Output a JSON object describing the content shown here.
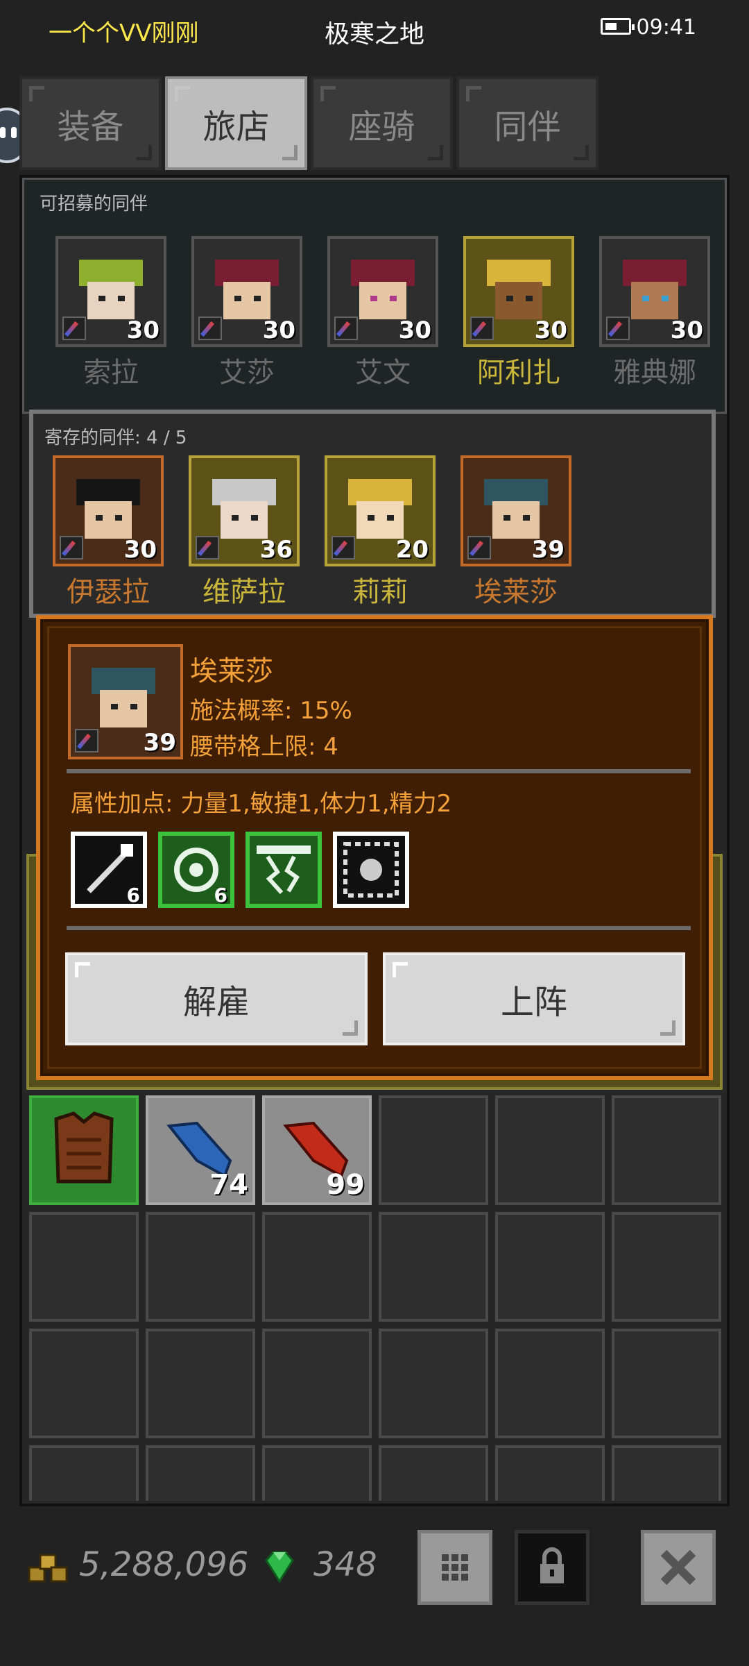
{
  "status_bar": {
    "app_name": "一个个VV刚刚",
    "screen_title": "极寒之地",
    "time": "09:41"
  },
  "tabs": [
    {
      "label": "装备",
      "active": false
    },
    {
      "label": "旅店",
      "active": true
    },
    {
      "label": "座骑",
      "active": false
    },
    {
      "label": "同伴",
      "active": false
    }
  ],
  "recruit": {
    "title": "可招募的同伴",
    "companions": [
      {
        "name": "索拉",
        "level": "30"
      },
      {
        "name": "艾莎",
        "level": "30"
      },
      {
        "name": "艾文",
        "level": "30"
      },
      {
        "name": "阿利扎",
        "level": "30"
      },
      {
        "name": "雅典娜",
        "level": "30"
      }
    ]
  },
  "storage": {
    "title": "寄存的同伴: 4 / 5",
    "companions": [
      {
        "name": "伊瑟拉",
        "level": "30"
      },
      {
        "name": "维萨拉",
        "level": "36"
      },
      {
        "name": "莉莉",
        "level": "20"
      },
      {
        "name": "埃莱莎",
        "level": "39"
      }
    ]
  },
  "detail": {
    "name": "埃莱莎",
    "level": "39",
    "cast_rate": "施法概率: 15%",
    "belt_limit": "腰带格上限: 4",
    "attributes": "属性加点: 力量1,敏捷1,体力1,精力2",
    "skills": [
      {
        "icon": "wand-skill-icon",
        "count": "6"
      },
      {
        "icon": "poison-skill-icon",
        "count": "6"
      },
      {
        "icon": "lightning-skill-icon",
        "count": ""
      },
      {
        "icon": "frost-skill-icon",
        "count": ""
      }
    ],
    "dismiss_label": "解雇",
    "deploy_label": "上阵"
  },
  "inventory": {
    "items": [
      {
        "icon": "leather-armor-icon",
        "qty": ""
      },
      {
        "icon": "blue-feather-icon",
        "qty": "74"
      },
      {
        "icon": "red-feather-icon",
        "qty": "99"
      }
    ]
  },
  "footer": {
    "gold": "5,288,096",
    "gems": "348",
    "buttons": [
      "grid-icon",
      "lock-icon",
      "close-icon"
    ]
  }
}
